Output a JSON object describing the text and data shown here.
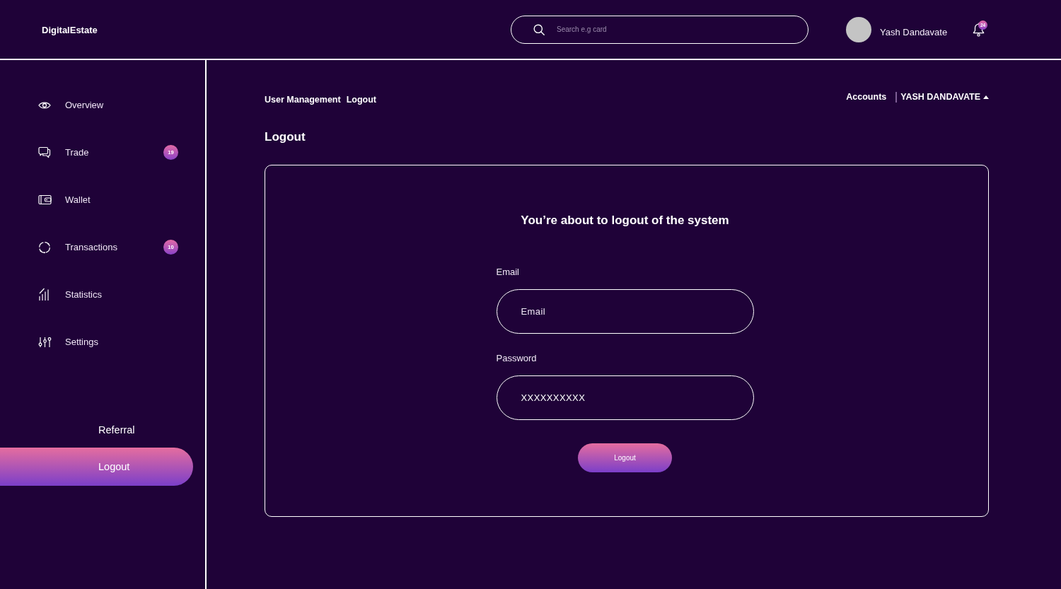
{
  "header": {
    "logo": "DigitalEstate",
    "search": {
      "placeholder": "Search e.g card"
    },
    "user": {
      "name": "Yash Dandavate"
    },
    "notifications": {
      "badge": "24"
    }
  },
  "sidebar": {
    "items": [
      {
        "label": "Overview"
      },
      {
        "label": "Trade",
        "badge": "19"
      },
      {
        "label": "Wallet"
      },
      {
        "label": "Transactions",
        "badge": "10"
      },
      {
        "label": "Statistics"
      },
      {
        "label": "Settings"
      }
    ],
    "footer_items": [
      {
        "label": "Referral",
        "selected": false
      },
      {
        "label": "Logout",
        "selected": true
      }
    ]
  },
  "main": {
    "breadcrumb": [
      "User Management",
      "Logout"
    ],
    "accounts_link": "Accounts",
    "account_menu": "YASH DANDAVATE",
    "title": "Logout",
    "card": {
      "heading": "You’re about to logout of the system",
      "fields": [
        {
          "label": "Email",
          "placeholder": "Email"
        },
        {
          "label": "Password",
          "value": "XXXXXXXXXX"
        }
      ],
      "button": "Logout"
    }
  }
}
